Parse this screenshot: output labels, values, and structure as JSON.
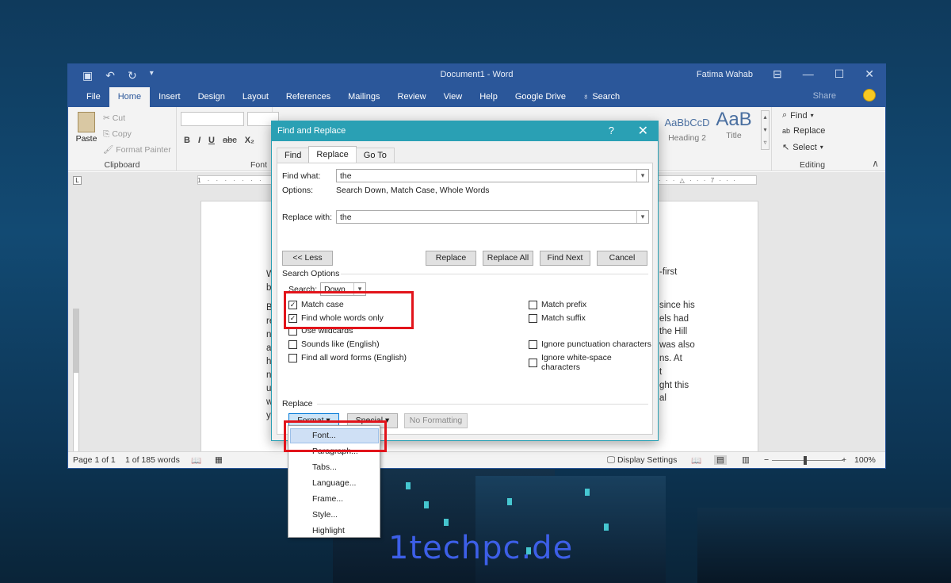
{
  "word": {
    "qat_icons": [
      "save-icon",
      "undo-icon",
      "redo-icon",
      "customize-icon"
    ],
    "title": "Document1  -  Word",
    "user": "Fatima Wahab",
    "tabs": [
      "File",
      "Home",
      "Insert",
      "Design",
      "Layout",
      "References",
      "Mailings",
      "Review",
      "View",
      "Help",
      "Google Drive"
    ],
    "tell_me": "Search",
    "share": "Share",
    "ribbon": {
      "clipboard": {
        "paste": "Paste",
        "cut": "Cut",
        "copy": "Copy",
        "format_painter": "Format Painter",
        "label": "Clipboard"
      },
      "font": {
        "label": "Font",
        "bold": "B",
        "italic": "I",
        "underline": "U",
        "strike": "abc",
        "sub": "X₂"
      },
      "styles": {
        "heading2_preview": "AaBbCcD",
        "heading2": "Heading 2",
        "title_preview": "AaB",
        "title": "Title"
      },
      "editing": {
        "find": "Find",
        "replace": "Replace",
        "select": "Select",
        "label": "Editing"
      }
    },
    "ruler_marks": "1 · · · · · · ·",
    "ruler_right": "· · · △ · · · 7 · · ·",
    "doc_left": [
      "W",
      "b",
      "B",
      "re",
      "n",
      "a",
      "h",
      "n",
      "u",
      "w",
      "y"
    ],
    "doc_right": [
      "-first",
      "",
      "since his",
      "els had",
      "the Hill",
      "was also",
      "ns. At",
      "t",
      "ght this",
      "al",
      ""
    ],
    "status": {
      "page": "Page 1 of 1",
      "words": "1 of 185 words",
      "display_settings": "Display Settings",
      "zoom": "100%"
    }
  },
  "dialog": {
    "title": "Find and Replace",
    "help": "?",
    "close": "✕",
    "tabs": [
      "Find",
      "Replace",
      "Go To"
    ],
    "find_what_label": "Find what:",
    "find_what_value": "the",
    "options_label": "Options:",
    "options_value": "Search Down, Match Case, Whole Words",
    "replace_with_label": "Replace with:",
    "replace_with_value": "the",
    "buttons": {
      "less": "<< Less",
      "replace": "Replace",
      "replace_all": "Replace All",
      "find_next": "Find Next",
      "cancel": "Cancel"
    },
    "search_options_label": "Search Options",
    "search_label": "Search:",
    "search_value": "Down",
    "left_options": [
      {
        "label": "Match case",
        "checked": true
      },
      {
        "label": "Find whole words only",
        "checked": true
      },
      {
        "label": "Use wildcards",
        "checked": false
      },
      {
        "label": "Sounds like (English)",
        "checked": false
      },
      {
        "label": "Find all word forms (English)",
        "checked": false
      }
    ],
    "right_options": [
      {
        "label": "Match prefix",
        "checked": false
      },
      {
        "label": "Match suffix",
        "checked": false
      },
      {
        "label": "Ignore punctuation characters",
        "checked": false
      },
      {
        "label": "Ignore white-space characters",
        "checked": false
      }
    ],
    "replace_section_label": "Replace",
    "format_btn": "Format ▾",
    "special_btn": "Special ▾",
    "no_formatting_btn": "No Formatting"
  },
  "format_menu": [
    "Font...",
    "Paragraph...",
    "Tabs...",
    "Language...",
    "Frame...",
    "Style...",
    "Highlight"
  ],
  "watermark": "1techpc.de",
  "colors": {
    "word_blue": "#2b579a",
    "dialog_teal": "#2aa0b4",
    "highlight_red": "#e2141b"
  }
}
